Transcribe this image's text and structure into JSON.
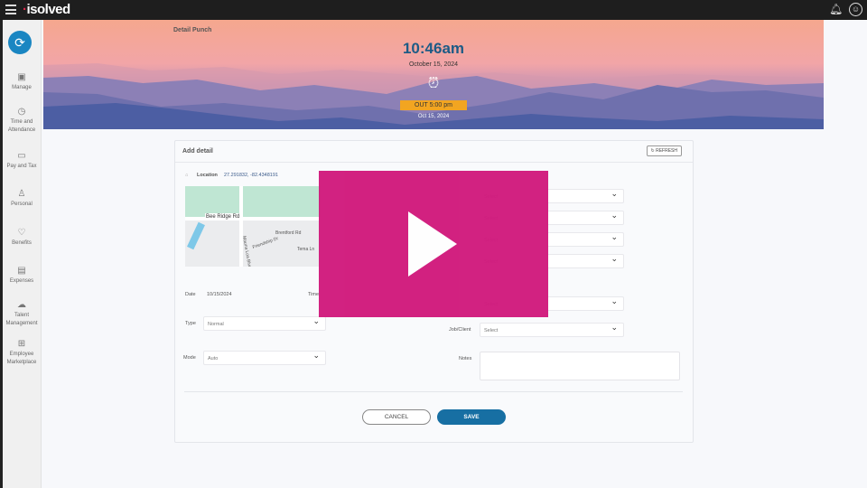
{
  "topbar": {
    "logo": "isolved",
    "logo_mark": "·"
  },
  "sidebar": {
    "items": [
      {
        "label": "Manage",
        "icon": "briefcase-icon"
      },
      {
        "label": "Time and Attendance",
        "icon": "clock-icon"
      },
      {
        "label": "Pay and Tax",
        "icon": "money-icon"
      },
      {
        "label": "Personal",
        "icon": "person-icon"
      },
      {
        "label": "Benefits",
        "icon": "heart-icon"
      },
      {
        "label": "Expenses",
        "icon": "receipt-icon"
      },
      {
        "label": "Talent Management",
        "icon": "cloud-icon"
      },
      {
        "label": "Employee Marketplace",
        "icon": "gift-icon"
      }
    ]
  },
  "banner": {
    "title": "Detail Punch",
    "time": "10:46am",
    "date": "October 15, 2024",
    "status": "OUT   5:00 pm",
    "status_date": "Oct 15, 2024"
  },
  "card": {
    "title": "Add detail",
    "refresh": "REFRESH",
    "location_label": "Location",
    "location_value": "27.291832, -82.4348191",
    "map_labels": [
      "Bee Ridge Rd",
      "Brentford Rd",
      "Friendship Dr",
      "Mauna Loa Blvd",
      "Tema Ln"
    ],
    "date_label": "Date",
    "date_value": "10/15/2024",
    "time_label": "Time",
    "type_label": "Type",
    "type_value": "Normal",
    "mode_label": "Mode",
    "mode_value": "Auto",
    "select_placeholder": "Select",
    "job_label": "Job/Client",
    "job_value": "Select",
    "notes_label": "Notes",
    "cancel": "CANCEL",
    "save": "SAVE"
  },
  "colors": {
    "accent": "#176fa3",
    "overlay": "#d11b7d",
    "status": "#f2a521"
  }
}
